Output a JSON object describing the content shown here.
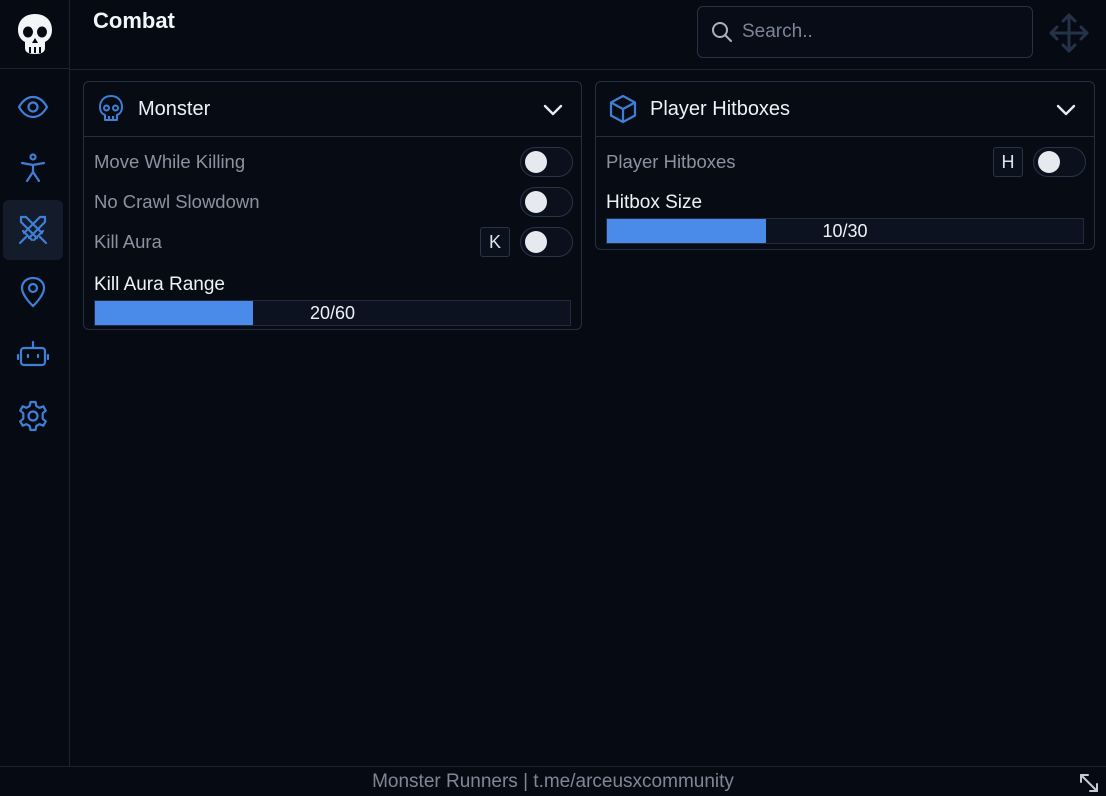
{
  "header": {
    "title": "Combat"
  },
  "search": {
    "placeholder": "Search.."
  },
  "sidebar": {
    "items": [
      {
        "name": "visuals",
        "icon": "eye-icon"
      },
      {
        "name": "player",
        "icon": "person-icon"
      },
      {
        "name": "combat",
        "icon": "crossed-swords-icon",
        "active": true
      },
      {
        "name": "teleport",
        "icon": "map-pin-icon"
      },
      {
        "name": "automation",
        "icon": "robot-icon"
      },
      {
        "name": "settings",
        "icon": "gear-icon"
      }
    ]
  },
  "panels": {
    "monster": {
      "title": "Monster",
      "icon": "skull-icon",
      "toggles": [
        {
          "label": "Move While Killing",
          "on": false
        },
        {
          "label": "No Crawl Slowdown",
          "on": false
        },
        {
          "label": "Kill Aura",
          "keybind": "K",
          "on": false
        }
      ],
      "slider": {
        "label": "Kill Aura Range",
        "value": 20,
        "max": 60,
        "display": "20/60"
      }
    },
    "hitboxes": {
      "title": "Player Hitboxes",
      "icon": "cube-icon",
      "toggles": [
        {
          "label": "Player Hitboxes",
          "keybind": "H",
          "on": false
        }
      ],
      "slider": {
        "label": "Hitbox Size",
        "value": 10,
        "max": 30,
        "display": "10/30"
      }
    }
  },
  "footer": {
    "text": "Monster Runners | t.me/arceusxcommunity"
  },
  "colors": {
    "accent": "#4a8ae8",
    "background": "#060a13",
    "border": "#252f42"
  }
}
